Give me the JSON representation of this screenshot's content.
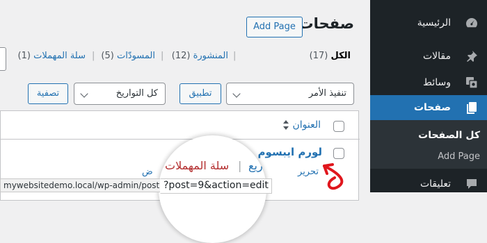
{
  "sidebar": {
    "items": [
      {
        "label": "الرئيسية",
        "icon": "dashboard-icon"
      },
      {
        "label": "مقالات",
        "icon": "pin-icon"
      },
      {
        "label": "وسائط",
        "icon": "media-icon"
      },
      {
        "label": "صفحات",
        "icon": "page-icon",
        "active": true
      },
      {
        "label": "تعليقات",
        "icon": "comment-icon"
      }
    ],
    "submenu": {
      "all_pages": "كل الصفحات",
      "add_page": "Add Page"
    }
  },
  "header": {
    "title": "صفحات",
    "add_button": "Add Page"
  },
  "status_filters": [
    {
      "label": "الكل",
      "count": "(17)",
      "current": true
    },
    {
      "label": "المنشورة",
      "count": "(12)"
    },
    {
      "label": "المسودّات",
      "count": "(5)"
    },
    {
      "label": "سلة المهملات",
      "count": "(1)"
    }
  ],
  "filters": {
    "bulk_action": "تنفيذ الأمر",
    "apply_button": "تطبيق",
    "dates": "كل التواريخ",
    "filter_button": "تصفية"
  },
  "table": {
    "column_title": "العنوان",
    "row": {
      "title": "لورم ايبسوم",
      "edit": "تحرير",
      "quick_edit": "تحرير سريع",
      "trash": "سلة المهملات",
      "view": "عرض"
    }
  },
  "magnifier": {
    "trash_link": "سلة المهملات",
    "trash_partial": "ريع",
    "url_part": "?post=9&action=edit"
  },
  "statusbar": {
    "url": "mywebsitedemo.local/wp-admin/post.php"
  },
  "colors": {
    "link": "#2271b1",
    "trash": "#b32d2e",
    "sidebar_bg": "#1d2327",
    "active_bg": "#2271b1",
    "annotation": "#e0161d"
  }
}
